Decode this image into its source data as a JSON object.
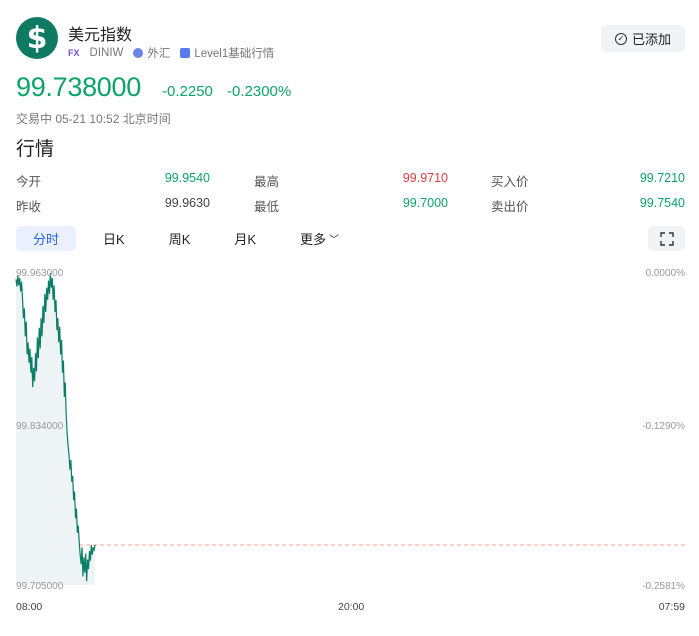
{
  "header": {
    "logo_glyph": "$",
    "title": "美元指数",
    "fx_badge": "FX",
    "code": "DINIW",
    "category": "外汇",
    "level": "Level1基础行情",
    "added_label": "已添加"
  },
  "quote": {
    "price": "99.738000",
    "change": "-0.2250",
    "change_pct": "-0.2300%",
    "status": "交易中 05-21 10:52 北京时间"
  },
  "section_title": "行情",
  "stats": {
    "open_label": "今开",
    "open_value": "99.9540",
    "high_label": "最高",
    "high_value": "99.9710",
    "bid_label": "买入价",
    "bid_value": "99.7210",
    "prev_close_label": "昨收",
    "prev_close_value": "99.9630",
    "low_label": "最低",
    "low_value": "99.7000",
    "ask_label": "卖出价",
    "ask_value": "99.7540"
  },
  "tabs": [
    "分时",
    "日K",
    "周K",
    "月K",
    "更多"
  ],
  "active_tab": 0,
  "colors": {
    "up": "#e03c3c",
    "down": "#0ca36a",
    "line": "#0a7d66",
    "accent": "#2a63e4"
  },
  "chart_data": {
    "type": "line",
    "y_left_ticks": [
      "99.963000",
      "99.834000",
      "99.705000"
    ],
    "y_right_ticks": [
      "0.0000%",
      "-0.1290%",
      "-0.2581%"
    ],
    "x_ticks": [
      "08:00",
      "20:00",
      "07:59"
    ],
    "ylim": [
      99.705,
      99.963
    ],
    "x_range_minutes": [
      0,
      1439
    ],
    "reference_line": 99.738,
    "series": [
      {
        "x": [
          0,
          2,
          4,
          6,
          8,
          10,
          12,
          14,
          16,
          18,
          20,
          22,
          24,
          26,
          28,
          30,
          32,
          34,
          36,
          38,
          40,
          42,
          44,
          46,
          48,
          50,
          52,
          54,
          56,
          58,
          60,
          62,
          64,
          66,
          68,
          70,
          72,
          74,
          76,
          78,
          80,
          82,
          84,
          86,
          88,
          90,
          92,
          94,
          96,
          98,
          100,
          102,
          104,
          106,
          108,
          110,
          112,
          114,
          116,
          118,
          120,
          122,
          124,
          126,
          128,
          130,
          132,
          134,
          136,
          138,
          140,
          142,
          144,
          146,
          148,
          150,
          152,
          154,
          156,
          158,
          160,
          162,
          164,
          166,
          168,
          170
        ],
        "values": [
          99.957,
          99.951,
          99.96,
          99.952,
          99.958,
          99.947,
          99.955,
          99.941,
          99.925,
          99.933,
          99.91,
          99.922,
          99.895,
          99.905,
          99.888,
          99.9,
          99.88,
          99.893,
          99.868,
          99.884,
          99.873,
          99.896,
          99.881,
          99.909,
          99.892,
          99.917,
          99.9,
          99.925,
          99.91,
          99.935,
          99.921,
          99.945,
          99.93,
          99.95,
          99.94,
          99.956,
          99.945,
          99.962,
          99.95,
          99.958,
          99.94,
          99.952,
          99.93,
          99.94,
          99.915,
          99.925,
          99.905,
          99.918,
          99.895,
          99.907,
          99.88,
          99.89,
          99.86,
          99.872,
          99.845,
          99.83,
          99.82,
          99.812,
          99.8,
          99.808,
          99.79,
          99.795,
          99.775,
          99.782,
          99.76,
          99.768,
          99.748,
          99.754,
          99.74,
          99.73,
          99.722,
          99.736,
          99.712,
          99.728,
          99.715,
          99.731,
          99.708,
          99.726,
          99.718,
          99.733,
          99.725,
          99.738,
          99.73,
          99.736,
          99.734,
          99.738
        ]
      }
    ]
  }
}
